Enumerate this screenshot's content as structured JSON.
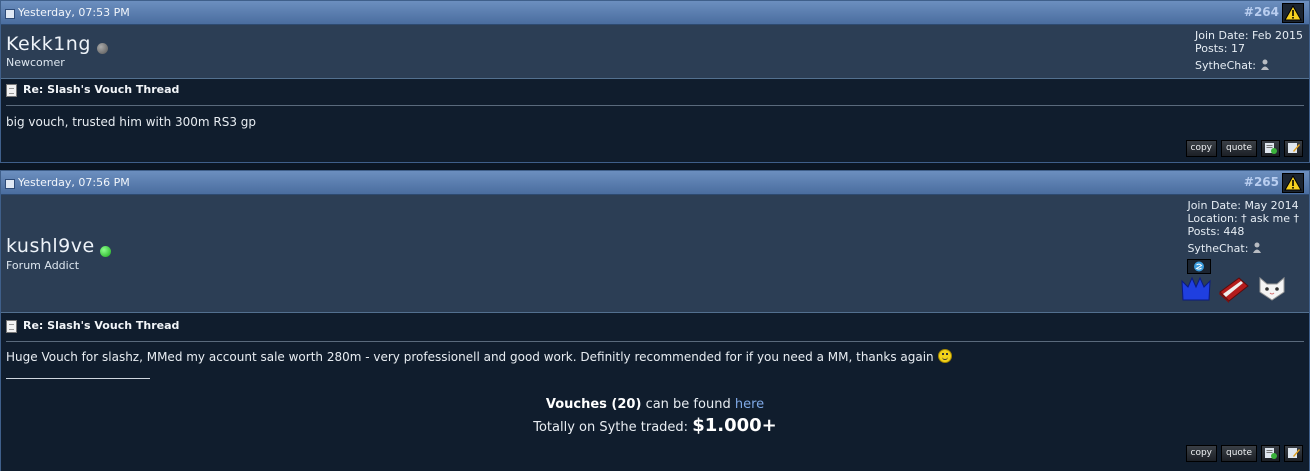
{
  "posts": [
    {
      "date": "Yesterday, 07:53 PM",
      "number": "#264",
      "username": "Kekk1ng",
      "online": false,
      "user_title": "Newcomer",
      "join_date": "Join Date: Feb 2015",
      "posts_count": "Posts: 17",
      "sythechat": "SytheChat:",
      "post_title": "Re: Slash's Vouch Thread",
      "message": "big vouch, trusted him with 300m RS3 gp",
      "buttons": {
        "copy": "copy",
        "quote": "quote"
      }
    },
    {
      "date": "Yesterday, 07:56 PM",
      "number": "#265",
      "username": "kushl9ve",
      "online": true,
      "user_title": "Forum Addict",
      "join_date": "Join Date: May 2014",
      "location": "Location: † ask me †",
      "posts_count": "Posts: 448",
      "sythechat": "SytheChat:",
      "post_title": "Re: Slash's Vouch Thread",
      "message": "Huge Vouch for slashz, MMed my account sale worth 280m - very professionell and good work. Definitly recommended for if you need a MM, thanks again",
      "signature": {
        "vouches_label": "Vouches (20)",
        "found_text": "can be found",
        "link_text": "here",
        "traded_text": "Totally on Sythe traded:",
        "traded_amount": "$1.000+"
      },
      "buttons": {
        "copy": "copy",
        "quote": "quote"
      }
    }
  ],
  "colors": {
    "header_blue": "#5a7fb1",
    "userbar": "#2c3e55",
    "body_bg": "#101d2d",
    "online_green": "#2fd12f",
    "offline_gray": "#6b6b6b",
    "link": "#7fa9e6"
  },
  "icons": [
    "report-warning-icon",
    "sythechat-person-icon",
    "skype-icon",
    "blue-crown-badge",
    "red-book-badge",
    "white-cat-badge",
    "profile-add-icon",
    "edit-icon"
  ]
}
